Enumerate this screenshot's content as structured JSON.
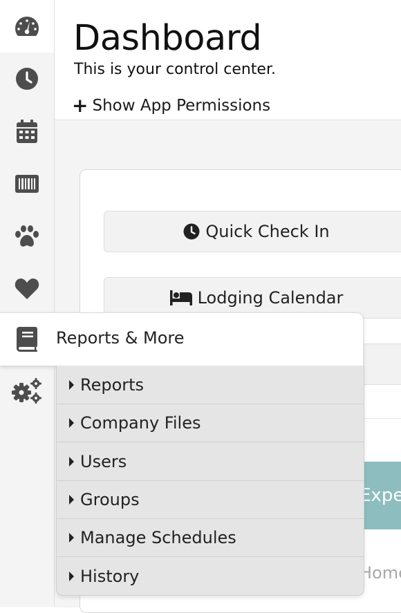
{
  "header": {
    "title": "Dashboard",
    "subtitle": "This is your control center.",
    "permissions_link": "Show App Permissions"
  },
  "sidebar": {
    "items": [
      {
        "name": "dashboard",
        "icon": "tachometer-icon"
      },
      {
        "name": "time-clock",
        "icon": "clock-icon"
      },
      {
        "name": "calendar",
        "icon": "calendar-icon"
      },
      {
        "name": "barcode",
        "icon": "barcode-icon"
      },
      {
        "name": "pets",
        "icon": "paw-icon"
      },
      {
        "name": "favorites",
        "icon": "heart-icon"
      },
      {
        "name": "reports",
        "icon": "book-icon"
      },
      {
        "name": "settings",
        "icon": "gears-icon"
      }
    ]
  },
  "main": {
    "quick_check_in": "Quick Check In",
    "lodging_calendar": "Lodging Calendar",
    "teal_button_fragment": "Expe",
    "home_fragment": "Home"
  },
  "menu": {
    "header": "Reports & More",
    "items": [
      "Reports",
      "Company Files",
      "Users",
      "Groups",
      "Manage Schedules",
      "History"
    ]
  },
  "colors": {
    "sidebar_bg": "#f4f4f4",
    "icon": "#4d4d4d",
    "teal_accent": "#8dbdbf",
    "submenu_bg": "#e5e5e5"
  }
}
